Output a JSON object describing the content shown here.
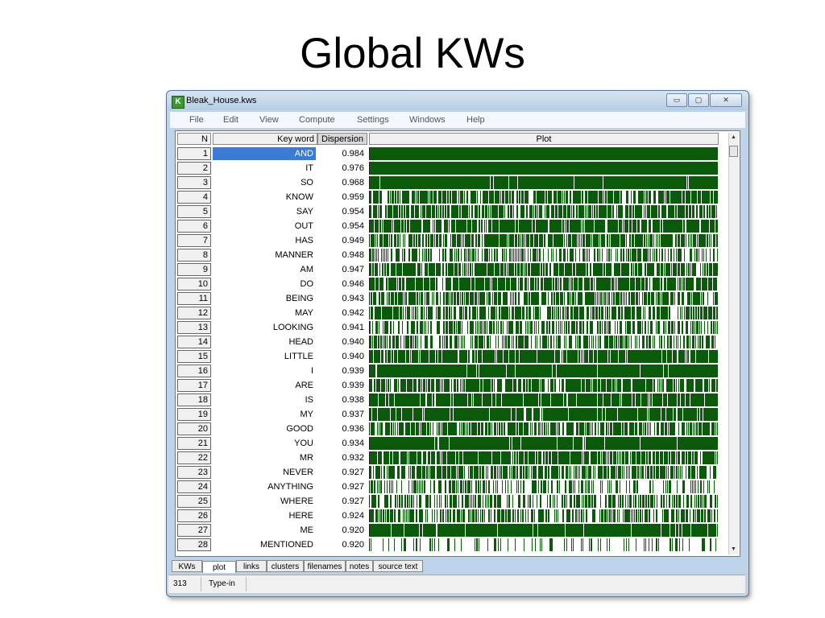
{
  "slide": {
    "title": "Global KWs"
  },
  "window": {
    "title": "Bleak_House.kws",
    "icon": "K",
    "min_label": "▭",
    "max_label": "▢",
    "close_label": "✕"
  },
  "menu": [
    "File",
    "Edit",
    "View",
    "Compute",
    "Settings",
    "Windows",
    "Help"
  ],
  "table": {
    "headers": {
      "n": "N",
      "keyword": "Key word",
      "dispersion": "Dispersion",
      "plot": "Plot"
    },
    "rows": [
      {
        "n": "1",
        "kw": "AND",
        "d": "0.984",
        "density": 1.0,
        "selected": true
      },
      {
        "n": "2",
        "kw": "IT",
        "d": "0.976",
        "density": 1.0
      },
      {
        "n": "3",
        "kw": "SO",
        "d": "0.968",
        "density": 0.97
      },
      {
        "n": "4",
        "kw": "KNOW",
        "d": "0.959",
        "density": 0.72
      },
      {
        "n": "5",
        "kw": "SAY",
        "d": "0.954",
        "density": 0.72
      },
      {
        "n": "6",
        "kw": "OUT",
        "d": "0.954",
        "density": 0.82
      },
      {
        "n": "7",
        "kw": "HAS",
        "d": "0.949",
        "density": 0.72
      },
      {
        "n": "8",
        "kw": "MANNER",
        "d": "0.948",
        "density": 0.45
      },
      {
        "n": "9",
        "kw": "AM",
        "d": "0.947",
        "density": 0.74
      },
      {
        "n": "10",
        "kw": "DO",
        "d": "0.946",
        "density": 0.78
      },
      {
        "n": "11",
        "kw": "BEING",
        "d": "0.943",
        "density": 0.62
      },
      {
        "n": "12",
        "kw": "MAY",
        "d": "0.942",
        "density": 0.66
      },
      {
        "n": "13",
        "kw": "LOOKING",
        "d": "0.941",
        "density": 0.5
      },
      {
        "n": "14",
        "kw": "HEAD",
        "d": "0.940",
        "density": 0.55
      },
      {
        "n": "15",
        "kw": "LITTLE",
        "d": "0.940",
        "density": 0.86
      },
      {
        "n": "16",
        "kw": "I",
        "d": "0.939",
        "density": 0.95
      },
      {
        "n": "17",
        "kw": "ARE",
        "d": "0.939",
        "density": 0.74
      },
      {
        "n": "18",
        "kw": "IS",
        "d": "0.938",
        "density": 0.9
      },
      {
        "n": "19",
        "kw": "MY",
        "d": "0.937",
        "density": 0.94
      },
      {
        "n": "20",
        "kw": "GOOD",
        "d": "0.936",
        "density": 0.7
      },
      {
        "n": "21",
        "kw": "YOU",
        "d": "0.934",
        "density": 0.97
      },
      {
        "n": "22",
        "kw": "MR",
        "d": "0.932",
        "density": 0.8
      },
      {
        "n": "23",
        "kw": "NEVER",
        "d": "0.927",
        "density": 0.7
      },
      {
        "n": "24",
        "kw": "ANYTHING",
        "d": "0.927",
        "density": 0.4
      },
      {
        "n": "25",
        "kw": "WHERE",
        "d": "0.927",
        "density": 0.5
      },
      {
        "n": "26",
        "kw": "HERE",
        "d": "0.924",
        "density": 0.55
      },
      {
        "n": "27",
        "kw": "ME",
        "d": "0.920",
        "density": 0.94
      },
      {
        "n": "28",
        "kw": "MENTIONED",
        "d": "0.920",
        "density": 0.22
      }
    ]
  },
  "tabs": [
    "KWs",
    "plot",
    "links",
    "clusters",
    "filenames",
    "notes",
    "source text"
  ],
  "active_tab": "plot",
  "status": {
    "count": "313",
    "mode": "Type-in"
  },
  "colors": {
    "plot_bar": "#0b5a0b",
    "selection": "#3b7bd6"
  }
}
